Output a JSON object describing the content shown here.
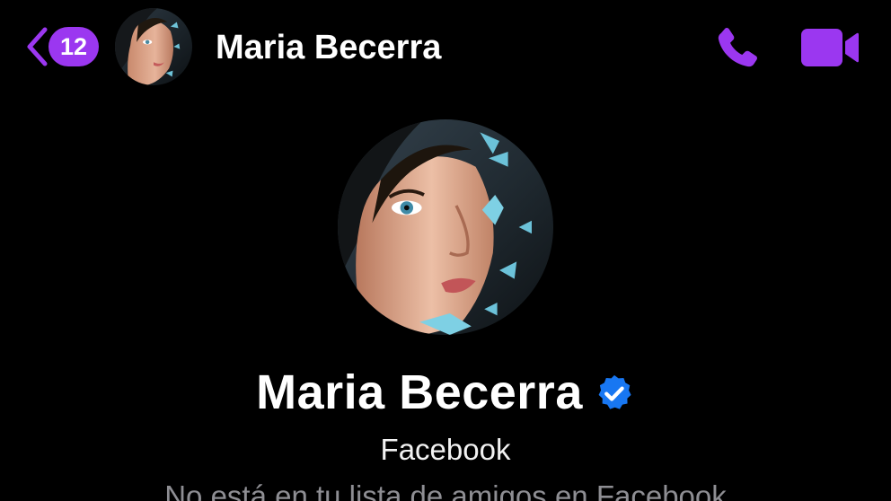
{
  "theme": {
    "accent": "#9b37f0",
    "background": "#000000",
    "verified": "#1877f2"
  },
  "header": {
    "back_icon": "chevron-left-icon",
    "unread_count": "12",
    "contact_name": "Maria Becerra",
    "call_icon": "phone-icon",
    "video_icon": "video-camera-icon"
  },
  "profile": {
    "name": "Maria Becerra",
    "verified_icon": "verified-badge-icon",
    "subtitle": "Facebook",
    "note": "No está en tu lista de amigos en Facebook"
  }
}
